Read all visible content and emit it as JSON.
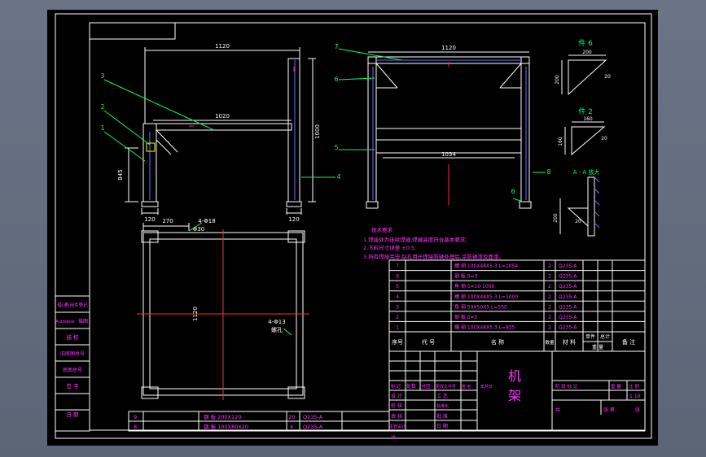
{
  "colors": {
    "background": "#000000",
    "frame": "#ffffff",
    "dimension": "#ffffff",
    "leader": "#00ff66",
    "part": "#6a6aff",
    "center": "#ff2a2a",
    "text_green": "#00ff66",
    "text_magenta": "#ff33ff",
    "text_yellow": "#ffff00",
    "text_cyan": "#00ffff"
  },
  "left_view": {
    "dims": {
      "top_width": "1120",
      "beam": "1020",
      "height": "1000",
      "side": "845",
      "base_w": "120",
      "base_w2": "120"
    },
    "callouts": [
      "3",
      "2",
      "1",
      "4"
    ]
  },
  "front_view": {
    "dims": {
      "top_width": "1120",
      "inner": "1034"
    },
    "callouts": [
      "7",
      "6",
      "5",
      "6",
      "8"
    ]
  },
  "details": {
    "part6_label": "件 6",
    "part6_dims": [
      "200",
      "200",
      "20"
    ],
    "part2_label": "件 2",
    "part2_dims": [
      "160",
      "160",
      "20"
    ],
    "section_label": "A - A 放大",
    "section_dim": "200",
    "section_dim2": "20"
  },
  "plan_view": {
    "dims": {
      "w": "270",
      "hole": "4-Φ18",
      "hole_sub": "Φ30",
      "h": "1120",
      "hole2": "4-Φ13",
      "hole2_sub": "螺孔"
    }
  },
  "tech_notes": {
    "title": "技术要求",
    "lines": [
      "1.焊接处为连续焊缝,焊缝高度符合基本要求;",
      "2.下料尺寸误差 ±0.5;",
      "3.所有焊接完毕,钻孔用于焊接防锈处理后,涂防锈漆及面漆。"
    ]
  },
  "bom": [
    {
      "no": "7",
      "code": "",
      "name": "槽 钢  100X48X5.3  L=1054",
      "qty": "2",
      "mat": "Q235-A"
    },
    {
      "no": "6",
      "code": "",
      "name": "钢 板  δ=3",
      "qty": "2",
      "mat": "Q235-A"
    },
    {
      "no": "5",
      "code": "",
      "name": "角 钢  δ=10  1000",
      "qty": "2",
      "mat": "Q235-A"
    },
    {
      "no": "4",
      "code": "",
      "name": "槽 钢  100X48X5.3  L=1000",
      "qty": "2",
      "mat": "Q235-A"
    },
    {
      "no": "3",
      "code": "",
      "name": "角 钢  50X50X5  L=550",
      "qty": "2",
      "mat": "Q235-A"
    },
    {
      "no": "2",
      "code": "",
      "name": "钢 板  δ=5",
      "qty": "2",
      "mat": "Q235-A"
    },
    {
      "no": "1",
      "code": "",
      "name": "槽 钢  100X48X5.3  L=835",
      "qty": "2",
      "mat": "Q235-A"
    }
  ],
  "bom_header": {
    "no": "序号",
    "code": "代 号",
    "name": "名 称",
    "qty": "数量",
    "mat": "材 料",
    "unit_w": "单件",
    "total_w": "总计",
    "weight": "重 量",
    "note": "备 注"
  },
  "bottom_bom": [
    {
      "no": "9",
      "name": "钢 板  200X120",
      "qty": "20",
      "mat": "Q235-A"
    },
    {
      "no": "8",
      "name": "钢 板  100X80X20",
      "qty": "4",
      "mat": "Q235-A"
    }
  ],
  "side_table": [
    "借(通)用件登记",
    "旧底图总号",
    "底图总号",
    "签 字",
    "日 期"
  ],
  "side_table_top": [
    "Autodesk",
    "描图",
    "描 校"
  ],
  "title_block": {
    "part_title": "机 架",
    "row1": [
      "标记",
      "处数",
      "分区",
      "更改文件号",
      "签 名",
      "年月日"
    ],
    "design": "设 计",
    "check": "校 核",
    "review": "审 核",
    "process": "工 艺",
    "std": "标准化",
    "approve": "批 准",
    "date": "日 期",
    "mgmt": "主管设计",
    "stage_label": "阶 段 标 记",
    "weight_label": "重 量",
    "scale_label": "比 例",
    "scale": "1:10",
    "sheets": "共",
    "sheet_no": "张 第",
    "sheet": "张",
    "bottom_text": "计"
  }
}
